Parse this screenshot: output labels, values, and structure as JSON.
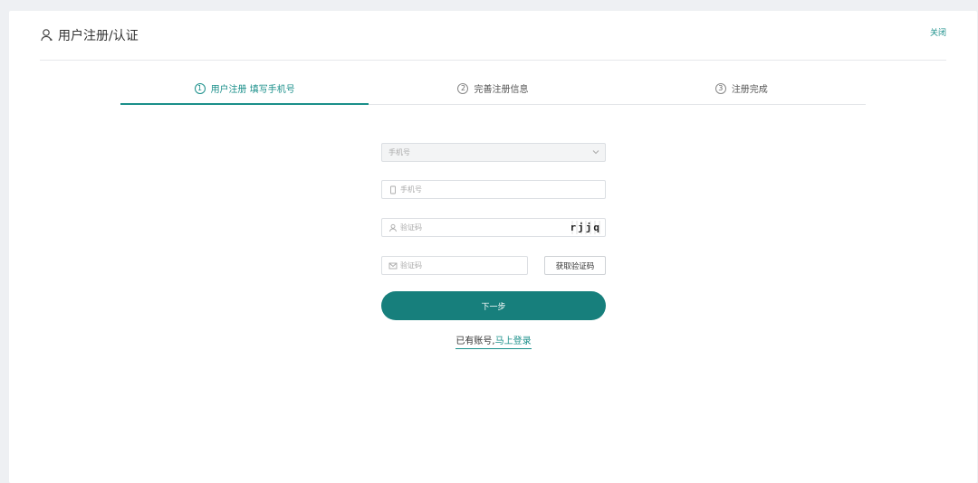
{
  "header": {
    "title": "用户注册/认证",
    "close_label": "关闭"
  },
  "steps": [
    {
      "num": "1",
      "label": "用户注册 填写手机号",
      "active": true
    },
    {
      "num": "2",
      "label": "完善注册信息",
      "active": false
    },
    {
      "num": "3",
      "label": "注册完成",
      "active": false
    }
  ],
  "form": {
    "country_select_placeholder": "手机号",
    "phone_placeholder": "手机号",
    "captcha_placeholder": "验证码",
    "captcha_text": "rjjq",
    "sms_code_placeholder": "验证码",
    "get_code_label": "获取验证码",
    "next_label": "下一步"
  },
  "footer": {
    "have_account": "已有账号,",
    "login_link": "马上登录"
  },
  "colors": {
    "accent": "#1a8f8a",
    "button": "#177f7c"
  }
}
